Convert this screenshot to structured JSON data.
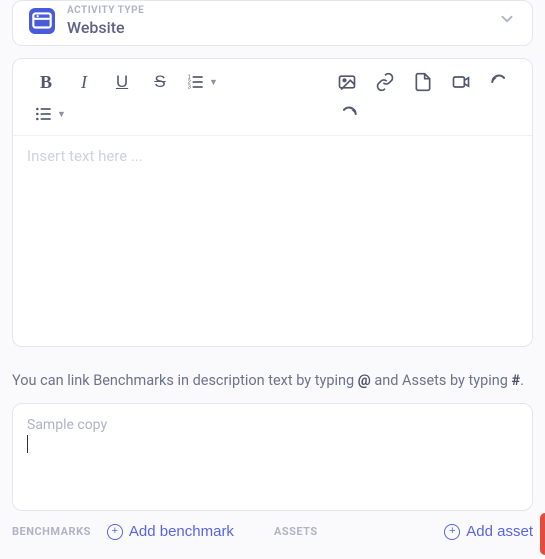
{
  "activity": {
    "label": "ACTIVITY TYPE",
    "value": "Website"
  },
  "editor": {
    "placeholder": "Insert text here ..."
  },
  "hint": {
    "pre": "You can link Benchmarks in description text by typing ",
    "at": "@",
    "mid": " and Assets by typing ",
    "hash": "#",
    "post": "."
  },
  "sample": {
    "placeholder": "Sample copy"
  },
  "benchmarks": {
    "label": "BENCHMARKS",
    "add_label": "Add benchmark"
  },
  "assets": {
    "label": "ASSETS",
    "add_label": "Add asset"
  }
}
